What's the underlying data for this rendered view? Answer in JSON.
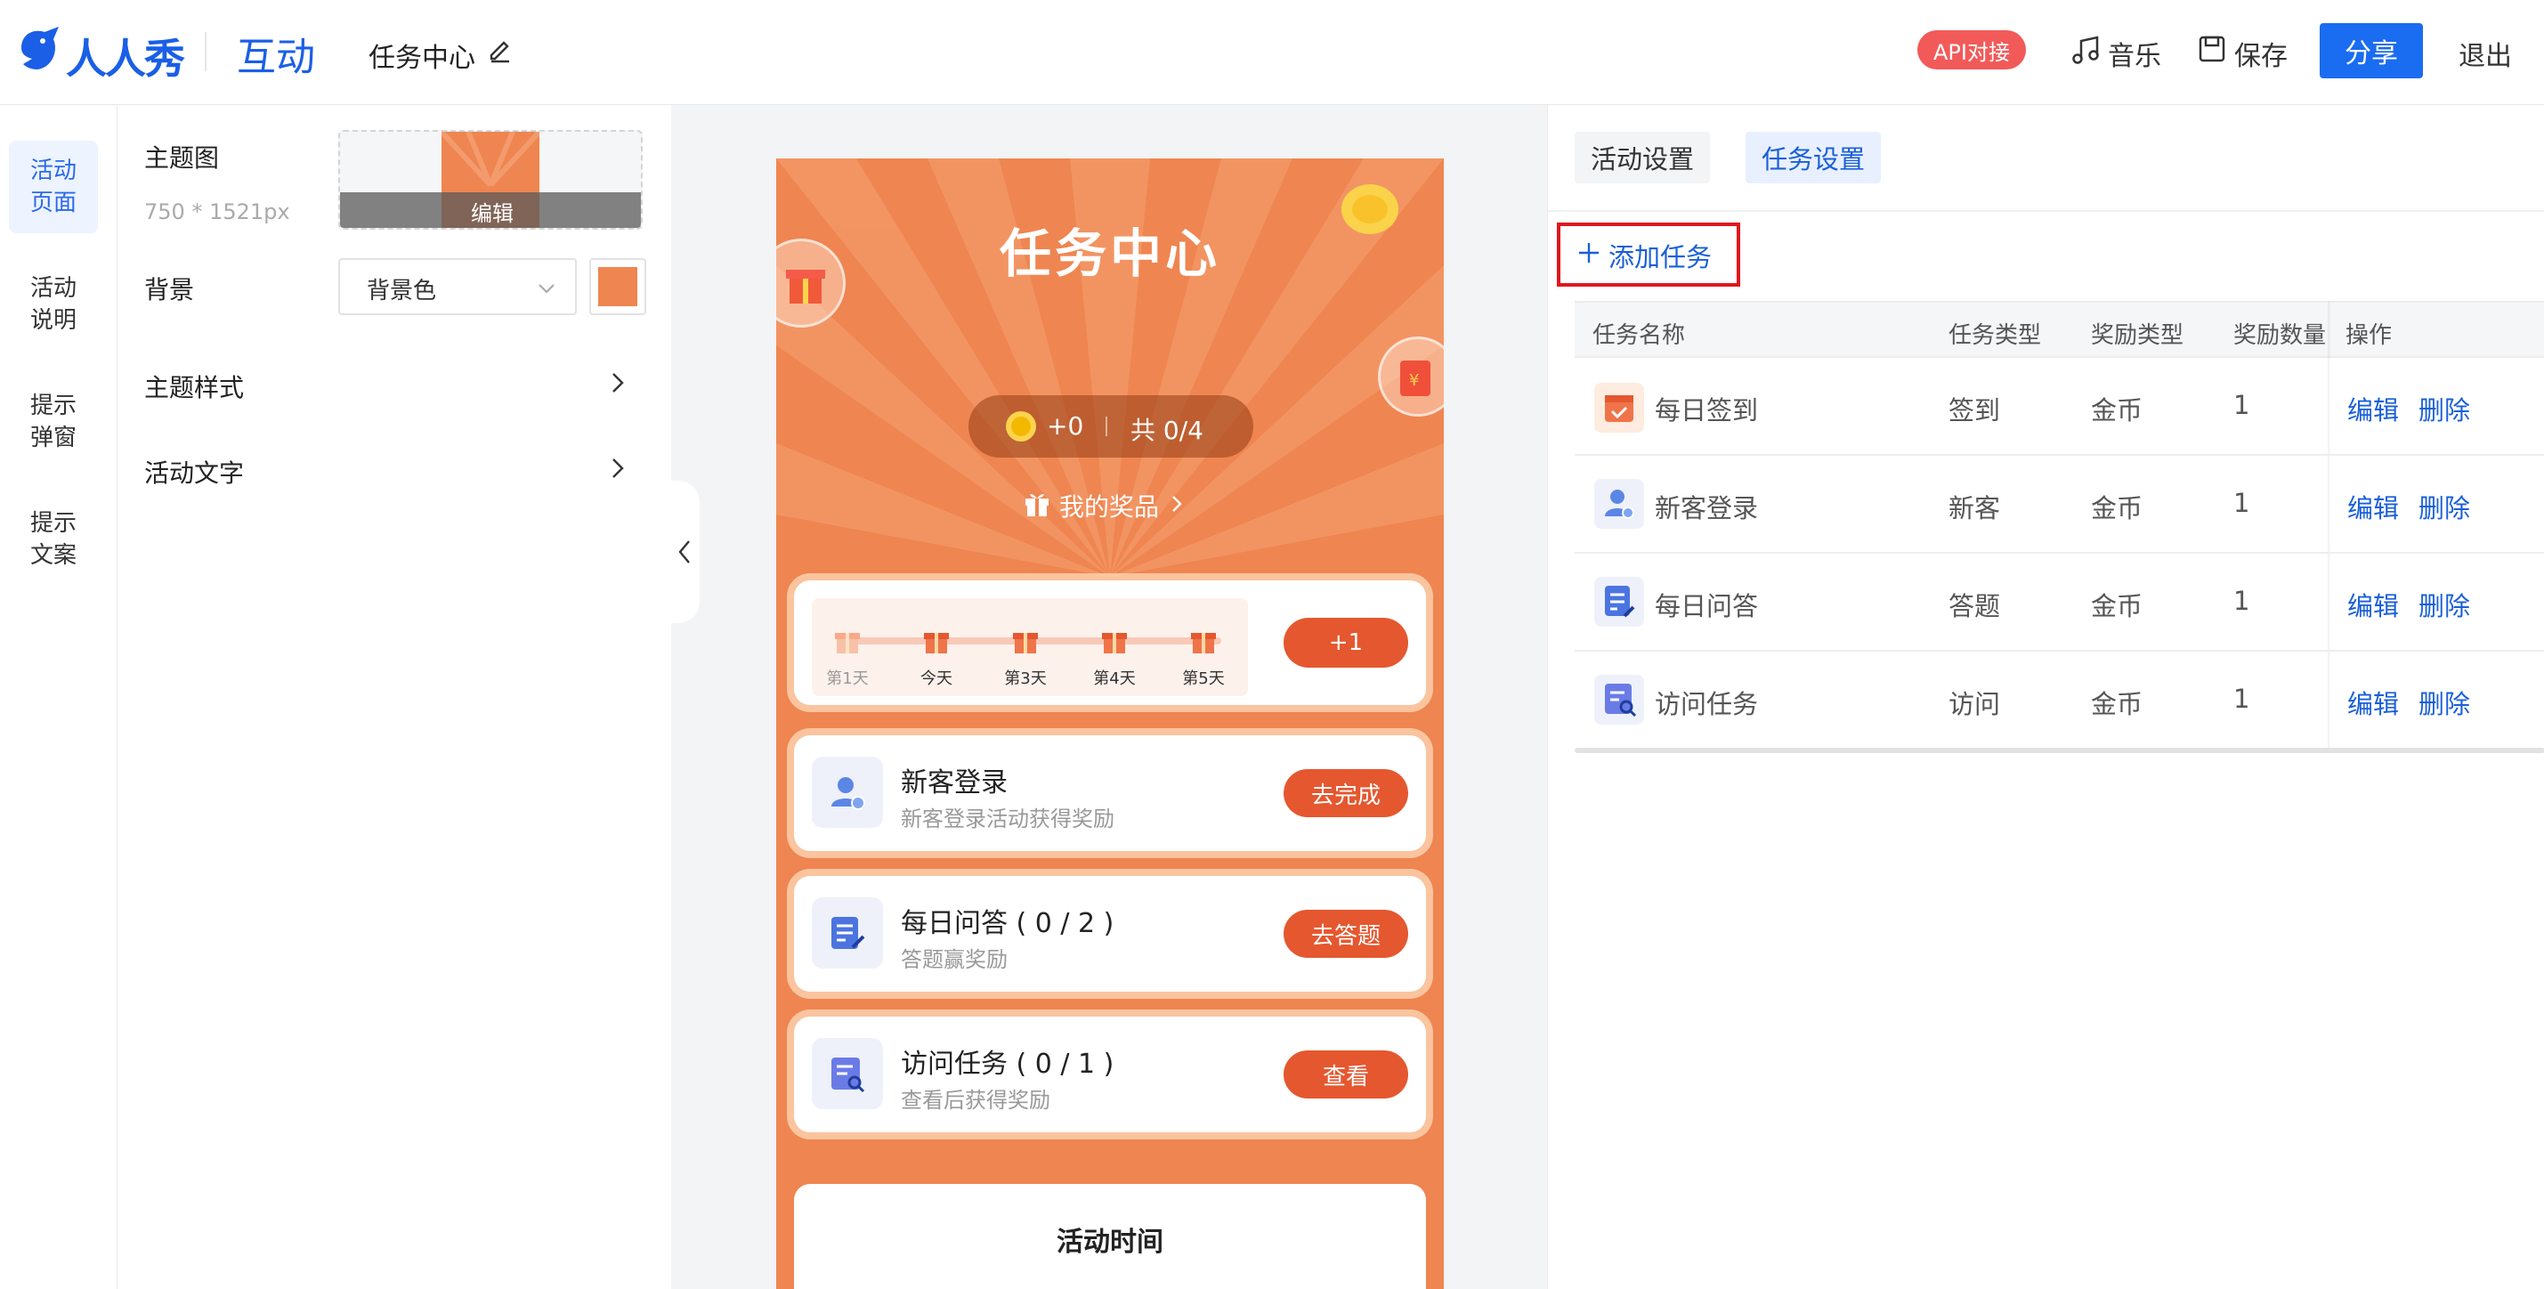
{
  "header": {
    "brand": "人人秀",
    "module": "互动",
    "doc_title": "任务中心",
    "api_badge": "API对接",
    "music_label": "音乐",
    "save_label": "保存",
    "share_label": "分享",
    "exit_label": "退出"
  },
  "leftnav": {
    "items": [
      {
        "label": "活动\n页面",
        "active": true
      },
      {
        "label": "活动\n说明",
        "active": false
      },
      {
        "label": "提示\n弹窗",
        "active": false
      },
      {
        "label": "提示\n文案",
        "active": false
      }
    ]
  },
  "props": {
    "theme_image_label": "主题图",
    "theme_image_size": "750 * 1521px",
    "edit_label": "编辑",
    "background_label": "背景",
    "background_select": "背景色",
    "background_color": "#ef8550",
    "theme_style_label": "主题样式",
    "activity_text_label": "活动文字"
  },
  "phone": {
    "title": "任务中心",
    "coins": "+0",
    "total": "共 0/4",
    "my_prizes": "我的奖品",
    "checkin": {
      "days": [
        "第1天",
        "今天",
        "第3天",
        "第4天",
        "第5天"
      ],
      "button": "+1"
    },
    "tasks": [
      {
        "name": "新客登录",
        "desc": "新客登录活动获得奖励",
        "button": "去完成"
      },
      {
        "name": "每日问答 ( 0 / 2 )",
        "desc": "答题赢奖励",
        "button": "去答题"
      },
      {
        "name": "访问任务 ( 0 / 1 )",
        "desc": "查看后获得奖励",
        "button": "查看"
      }
    ],
    "activity_time": "活动时间"
  },
  "right": {
    "tabs": [
      "活动设置",
      "任务设置"
    ],
    "active_tab": 1,
    "add_task": "添加任务",
    "columns": [
      "任务名称",
      "任务类型",
      "奖励类型",
      "奖励数量",
      "操作"
    ],
    "rows": [
      {
        "name": "每日签到",
        "type": "签到",
        "reward_type": "金币",
        "amount": "1",
        "icon": "calendar-check-icon"
      },
      {
        "name": "新客登录",
        "type": "新客",
        "reward_type": "金币",
        "amount": "1",
        "icon": "user-add-icon"
      },
      {
        "name": "每日问答",
        "type": "答题",
        "reward_type": "金币",
        "amount": "1",
        "icon": "quiz-edit-icon"
      },
      {
        "name": "访问任务",
        "type": "访问",
        "reward_type": "金币",
        "amount": "1",
        "icon": "visit-search-icon"
      }
    ],
    "edit_label": "编辑",
    "delete_label": "删除"
  },
  "colors": {
    "primary": "#1a6cf0",
    "accent": "#ef8550",
    "highlight_box": "#e0161d",
    "badge": "#f25a5a"
  }
}
